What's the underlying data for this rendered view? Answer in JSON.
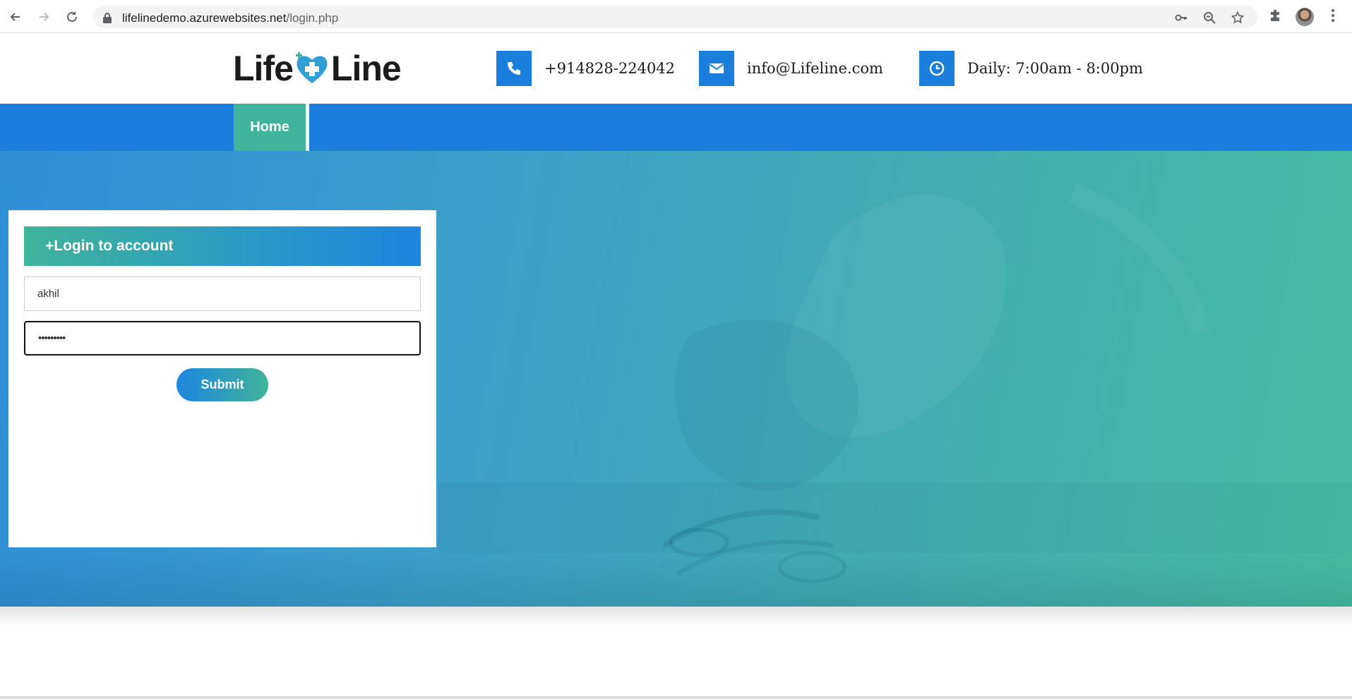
{
  "browser": {
    "url_host": "lifelinedemo.azurewebsites.net",
    "url_path": "/login.php",
    "icons": [
      "back-icon",
      "forward-icon",
      "reload-icon",
      "lock-icon",
      "key-icon",
      "zoom-icon",
      "star-icon",
      "extensions-icon",
      "menu-icon"
    ]
  },
  "header": {
    "logo_part1": "Life",
    "logo_part2": "Line",
    "phone": "+914828-224042",
    "email": "info@Lifeline.com",
    "hours": "Daily: 7:00am - 8:00pm"
  },
  "nav": {
    "home_label": "Home"
  },
  "login": {
    "title": "+Login to account",
    "username_value": "akhil",
    "password_value": "•••••••••",
    "submit_label": "Submit"
  },
  "colors": {
    "primary_blue": "#1a7fdc",
    "accent_green": "#3fb49a"
  }
}
